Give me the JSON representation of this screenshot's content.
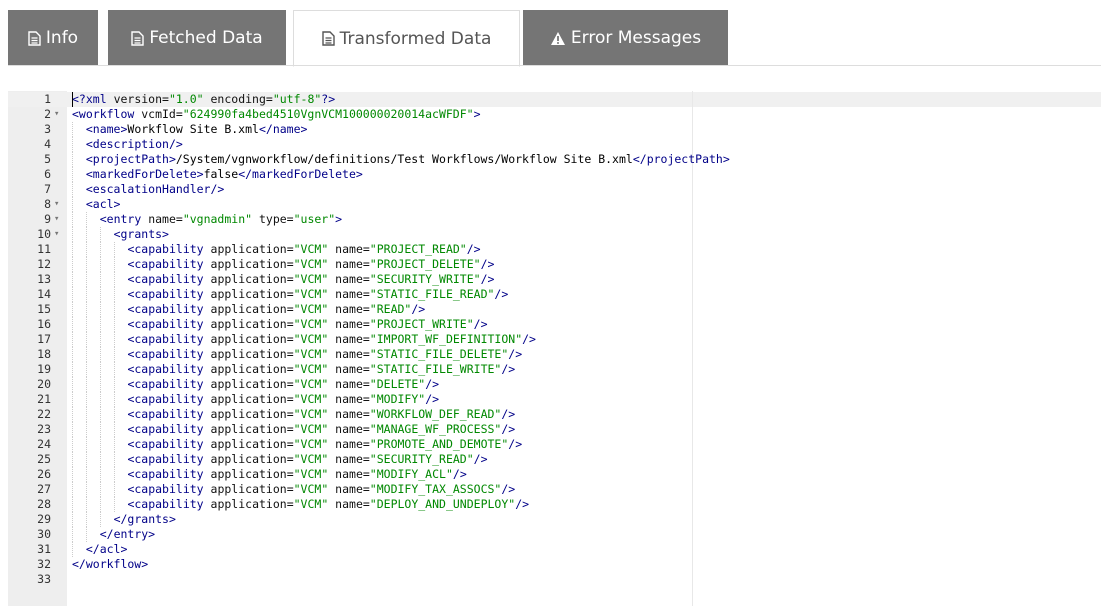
{
  "tabs": [
    {
      "label": "Info",
      "icon": "file-text-icon",
      "active": false
    },
    {
      "label": "Fetched Data",
      "icon": "file-text-icon",
      "active": false
    },
    {
      "label": "Transformed Data",
      "icon": "file-text-icon",
      "active": true
    },
    {
      "label": "Error Messages",
      "icon": "warning-triangle-icon",
      "active": false
    }
  ],
  "colors": {
    "tab_bg": "#757575",
    "tag": "#000088",
    "attr_value": "#008800",
    "gutter": "#eeeeee"
  },
  "editor": {
    "lines": [
      {
        "n": "1",
        "fold": false,
        "indent": 0,
        "tokens": [
          [
            "pi",
            "<?"
          ],
          [
            "t",
            "xml"
          ],
          [
            "an",
            " version="
          ],
          [
            "av",
            "\"1.0\""
          ],
          [
            "an",
            " encoding="
          ],
          [
            "av",
            "\"utf-8\""
          ],
          [
            "pi",
            "?>"
          ]
        ]
      },
      {
        "n": "2",
        "fold": true,
        "indent": 0,
        "tokens": [
          [
            "t",
            "<workflow"
          ],
          [
            "an",
            " vcmId="
          ],
          [
            "av",
            "\"624990fa4bed4510VgnVCM100000020014acWFDF\""
          ],
          [
            "t",
            ">"
          ]
        ]
      },
      {
        "n": "3",
        "fold": false,
        "indent": 1,
        "tokens": [
          [
            "t",
            "<name>"
          ],
          [
            "tx",
            "Workflow Site B.xml"
          ],
          [
            "t",
            "</name>"
          ]
        ]
      },
      {
        "n": "4",
        "fold": false,
        "indent": 1,
        "tokens": [
          [
            "t",
            "<description/>"
          ]
        ]
      },
      {
        "n": "5",
        "fold": false,
        "indent": 1,
        "tokens": [
          [
            "t",
            "<projectPath>"
          ],
          [
            "tx",
            "/System/vgnworkflow/definitions/Test Workflows/Workflow Site B.xml"
          ],
          [
            "t",
            "</projectPath>"
          ]
        ]
      },
      {
        "n": "6",
        "fold": false,
        "indent": 1,
        "tokens": [
          [
            "t",
            "<markedForDelete>"
          ],
          [
            "tx",
            "false"
          ],
          [
            "t",
            "</markedForDelete>"
          ]
        ]
      },
      {
        "n": "7",
        "fold": false,
        "indent": 1,
        "tokens": [
          [
            "t",
            "<escalationHandler/>"
          ]
        ]
      },
      {
        "n": "8",
        "fold": true,
        "indent": 1,
        "tokens": [
          [
            "t",
            "<acl>"
          ]
        ]
      },
      {
        "n": "9",
        "fold": true,
        "indent": 2,
        "tokens": [
          [
            "t",
            "<entry"
          ],
          [
            "an",
            " name="
          ],
          [
            "av",
            "\"vgnadmin\""
          ],
          [
            "an",
            " type="
          ],
          [
            "av",
            "\"user\""
          ],
          [
            "t",
            ">"
          ]
        ]
      },
      {
        "n": "10",
        "fold": true,
        "indent": 3,
        "tokens": [
          [
            "t",
            "<grants>"
          ]
        ]
      },
      {
        "n": "11",
        "fold": false,
        "indent": 4,
        "tokens": [
          [
            "t",
            "<capability"
          ],
          [
            "an",
            " application="
          ],
          [
            "av",
            "\"VCM\""
          ],
          [
            "an",
            " name="
          ],
          [
            "av",
            "\"PROJECT_READ\""
          ],
          [
            "t",
            "/>"
          ]
        ]
      },
      {
        "n": "12",
        "fold": false,
        "indent": 4,
        "tokens": [
          [
            "t",
            "<capability"
          ],
          [
            "an",
            " application="
          ],
          [
            "av",
            "\"VCM\""
          ],
          [
            "an",
            " name="
          ],
          [
            "av",
            "\"PROJECT_DELETE\""
          ],
          [
            "t",
            "/>"
          ]
        ]
      },
      {
        "n": "13",
        "fold": false,
        "indent": 4,
        "tokens": [
          [
            "t",
            "<capability"
          ],
          [
            "an",
            " application="
          ],
          [
            "av",
            "\"VCM\""
          ],
          [
            "an",
            " name="
          ],
          [
            "av",
            "\"SECURITY_WRITE\""
          ],
          [
            "t",
            "/>"
          ]
        ]
      },
      {
        "n": "14",
        "fold": false,
        "indent": 4,
        "tokens": [
          [
            "t",
            "<capability"
          ],
          [
            "an",
            " application="
          ],
          [
            "av",
            "\"VCM\""
          ],
          [
            "an",
            " name="
          ],
          [
            "av",
            "\"STATIC_FILE_READ\""
          ],
          [
            "t",
            "/>"
          ]
        ]
      },
      {
        "n": "15",
        "fold": false,
        "indent": 4,
        "tokens": [
          [
            "t",
            "<capability"
          ],
          [
            "an",
            " application="
          ],
          [
            "av",
            "\"VCM\""
          ],
          [
            "an",
            " name="
          ],
          [
            "av",
            "\"READ\""
          ],
          [
            "t",
            "/>"
          ]
        ]
      },
      {
        "n": "16",
        "fold": false,
        "indent": 4,
        "tokens": [
          [
            "t",
            "<capability"
          ],
          [
            "an",
            " application="
          ],
          [
            "av",
            "\"VCM\""
          ],
          [
            "an",
            " name="
          ],
          [
            "av",
            "\"PROJECT_WRITE\""
          ],
          [
            "t",
            "/>"
          ]
        ]
      },
      {
        "n": "17",
        "fold": false,
        "indent": 4,
        "tokens": [
          [
            "t",
            "<capability"
          ],
          [
            "an",
            " application="
          ],
          [
            "av",
            "\"VCM\""
          ],
          [
            "an",
            " name="
          ],
          [
            "av",
            "\"IMPORT_WF_DEFINITION\""
          ],
          [
            "t",
            "/>"
          ]
        ]
      },
      {
        "n": "18",
        "fold": false,
        "indent": 4,
        "tokens": [
          [
            "t",
            "<capability"
          ],
          [
            "an",
            " application="
          ],
          [
            "av",
            "\"VCM\""
          ],
          [
            "an",
            " name="
          ],
          [
            "av",
            "\"STATIC_FILE_DELETE\""
          ],
          [
            "t",
            "/>"
          ]
        ]
      },
      {
        "n": "19",
        "fold": false,
        "indent": 4,
        "tokens": [
          [
            "t",
            "<capability"
          ],
          [
            "an",
            " application="
          ],
          [
            "av",
            "\"VCM\""
          ],
          [
            "an",
            " name="
          ],
          [
            "av",
            "\"STATIC_FILE_WRITE\""
          ],
          [
            "t",
            "/>"
          ]
        ]
      },
      {
        "n": "20",
        "fold": false,
        "indent": 4,
        "tokens": [
          [
            "t",
            "<capability"
          ],
          [
            "an",
            " application="
          ],
          [
            "av",
            "\"VCM\""
          ],
          [
            "an",
            " name="
          ],
          [
            "av",
            "\"DELETE\""
          ],
          [
            "t",
            "/>"
          ]
        ]
      },
      {
        "n": "21",
        "fold": false,
        "indent": 4,
        "tokens": [
          [
            "t",
            "<capability"
          ],
          [
            "an",
            " application="
          ],
          [
            "av",
            "\"VCM\""
          ],
          [
            "an",
            " name="
          ],
          [
            "av",
            "\"MODIFY\""
          ],
          [
            "t",
            "/>"
          ]
        ]
      },
      {
        "n": "22",
        "fold": false,
        "indent": 4,
        "tokens": [
          [
            "t",
            "<capability"
          ],
          [
            "an",
            " application="
          ],
          [
            "av",
            "\"VCM\""
          ],
          [
            "an",
            " name="
          ],
          [
            "av",
            "\"WORKFLOW_DEF_READ\""
          ],
          [
            "t",
            "/>"
          ]
        ]
      },
      {
        "n": "23",
        "fold": false,
        "indent": 4,
        "tokens": [
          [
            "t",
            "<capability"
          ],
          [
            "an",
            " application="
          ],
          [
            "av",
            "\"VCM\""
          ],
          [
            "an",
            " name="
          ],
          [
            "av",
            "\"MANAGE_WF_PROCESS\""
          ],
          [
            "t",
            "/>"
          ]
        ]
      },
      {
        "n": "24",
        "fold": false,
        "indent": 4,
        "tokens": [
          [
            "t",
            "<capability"
          ],
          [
            "an",
            " application="
          ],
          [
            "av",
            "\"VCM\""
          ],
          [
            "an",
            " name="
          ],
          [
            "av",
            "\"PROMOTE_AND_DEMOTE\""
          ],
          [
            "t",
            "/>"
          ]
        ]
      },
      {
        "n": "25",
        "fold": false,
        "indent": 4,
        "tokens": [
          [
            "t",
            "<capability"
          ],
          [
            "an",
            " application="
          ],
          [
            "av",
            "\"VCM\""
          ],
          [
            "an",
            " name="
          ],
          [
            "av",
            "\"SECURITY_READ\""
          ],
          [
            "t",
            "/>"
          ]
        ]
      },
      {
        "n": "26",
        "fold": false,
        "indent": 4,
        "tokens": [
          [
            "t",
            "<capability"
          ],
          [
            "an",
            " application="
          ],
          [
            "av",
            "\"VCM\""
          ],
          [
            "an",
            " name="
          ],
          [
            "av",
            "\"MODIFY_ACL\""
          ],
          [
            "t",
            "/>"
          ]
        ]
      },
      {
        "n": "27",
        "fold": false,
        "indent": 4,
        "tokens": [
          [
            "t",
            "<capability"
          ],
          [
            "an",
            " application="
          ],
          [
            "av",
            "\"VCM\""
          ],
          [
            "an",
            " name="
          ],
          [
            "av",
            "\"MODIFY_TAX_ASSOCS\""
          ],
          [
            "t",
            "/>"
          ]
        ]
      },
      {
        "n": "28",
        "fold": false,
        "indent": 4,
        "tokens": [
          [
            "t",
            "<capability"
          ],
          [
            "an",
            " application="
          ],
          [
            "av",
            "\"VCM\""
          ],
          [
            "an",
            " name="
          ],
          [
            "av",
            "\"DEPLOY_AND_UNDEPLOY\""
          ],
          [
            "t",
            "/>"
          ]
        ]
      },
      {
        "n": "29",
        "fold": false,
        "indent": 3,
        "tokens": [
          [
            "t",
            "</grants>"
          ]
        ]
      },
      {
        "n": "30",
        "fold": false,
        "indent": 2,
        "tokens": [
          [
            "t",
            "</entry>"
          ]
        ]
      },
      {
        "n": "31",
        "fold": false,
        "indent": 1,
        "tokens": [
          [
            "t",
            "</acl>"
          ]
        ]
      },
      {
        "n": "32",
        "fold": false,
        "indent": 0,
        "tokens": [
          [
            "t",
            "</workflow>"
          ]
        ]
      },
      {
        "n": "33",
        "fold": false,
        "indent": 0,
        "tokens": []
      }
    ]
  }
}
